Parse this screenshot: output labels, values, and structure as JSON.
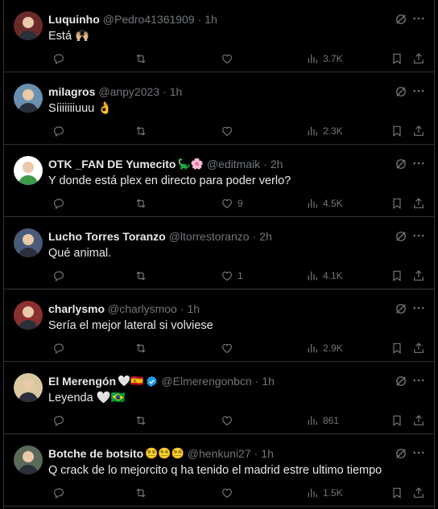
{
  "tweets": [
    {
      "name": "Luquinho",
      "name_emoji": "",
      "verified": false,
      "handle": "@Pedro41361909",
      "time": "1h",
      "text": "Está 🙌🏼",
      "replies": "",
      "retweets": "",
      "likes": "",
      "views": "3.7K",
      "avatar_color": "#6b2a2a"
    },
    {
      "name": "milagros",
      "name_emoji": "",
      "verified": false,
      "handle": "@anpy2023",
      "time": "1h",
      "text": "Síiiiiiiuuu 👌",
      "replies": "",
      "retweets": "",
      "likes": "",
      "views": "2.3K",
      "avatar_color": "#6a8fb0"
    },
    {
      "name": "OTK _FAN DE Yumecito",
      "name_emoji": "🦕🌸",
      "verified": false,
      "handle": "@editmaik",
      "time": "2h",
      "text": "Y donde está plex en directo para poder verlo?",
      "replies": "",
      "retweets": "",
      "likes": "9",
      "views": "4.5K",
      "avatar_color": "#ffffff"
    },
    {
      "name": "Lucho Torres Toranzo",
      "name_emoji": "",
      "verified": false,
      "handle": "@ltorrestoranzo",
      "time": "2h",
      "text": "Qué animal.",
      "replies": "",
      "retweets": "",
      "likes": "1",
      "views": "4.1K",
      "avatar_color": "#4a5a7a"
    },
    {
      "name": "charlysmo",
      "name_emoji": "",
      "verified": false,
      "handle": "@charlysmoo",
      "time": "1h",
      "text": "Sería el mejor lateral si volviese",
      "replies": "",
      "retweets": "",
      "likes": "",
      "views": "2.9K",
      "avatar_color": "#8a3030"
    },
    {
      "name": "El Merengón",
      "name_emoji": "🤍🇪🇸",
      "verified": true,
      "handle": "@Elmerengonbcn",
      "time": "1h",
      "text": "Leyenda 🤍🇧🇷",
      "replies": "",
      "retweets": "",
      "likes": "",
      "views": "861",
      "avatar_color": "#d8c9a0"
    },
    {
      "name": "Botche de botsito",
      "name_emoji": "😵‍💫😵‍💫😵‍💫",
      "verified": false,
      "handle": "@henkuni27",
      "time": "1h",
      "text": "Q crack de lo mejorcito q ha tenido el madrid estre ultimo tiempo",
      "replies": "",
      "retweets": "",
      "likes": "",
      "views": "1.5K",
      "avatar_color": "#5a6a5a"
    }
  ],
  "separator": "·",
  "icons": {
    "reply": "reply-icon",
    "retweet": "retweet-icon",
    "like": "heart-icon",
    "views": "views-icon",
    "bookmark": "bookmark-icon",
    "share": "share-icon",
    "grok": "grok-icon",
    "more": "more-icon"
  },
  "colors": {
    "background": "#000000",
    "text": "#e7e9ea",
    "muted": "#71767b",
    "border": "#2f3336",
    "verified": "#1d9bf0"
  }
}
